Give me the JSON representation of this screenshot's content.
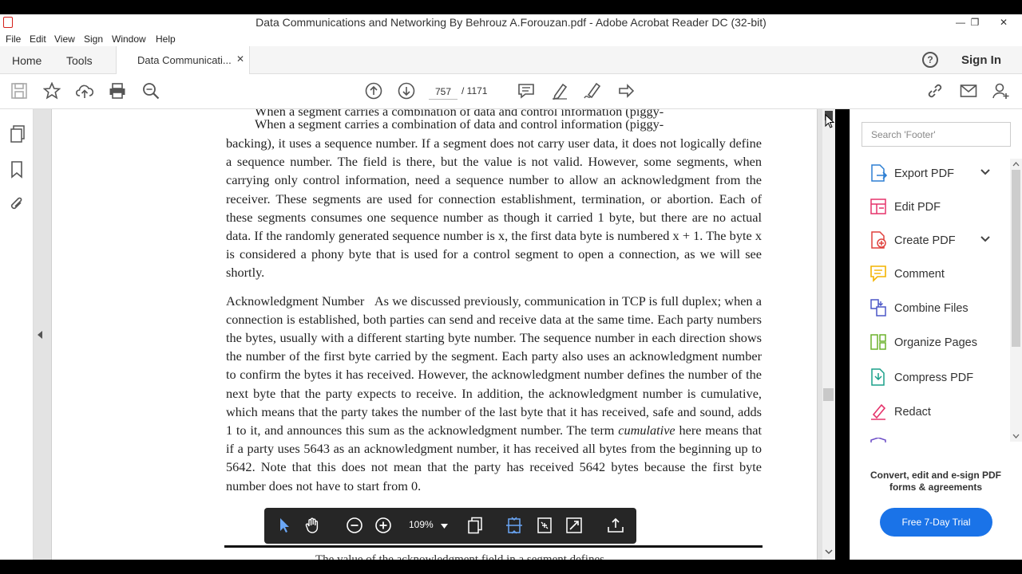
{
  "window": {
    "title": "Data Communications and Networking By Behrouz A.Forouzan.pdf - Adobe Acrobat Reader DC (32-bit)",
    "minimize": "—",
    "restore": "❐",
    "close": "✕"
  },
  "menu": [
    "File",
    "Edit",
    "View",
    "Sign",
    "Window",
    "Help"
  ],
  "tabs": {
    "home": "Home",
    "tools": "Tools",
    "document": "Data Communicati...",
    "close": "✕"
  },
  "header": {
    "help_icon": "?",
    "sign_in": "Sign In"
  },
  "toolbar": {
    "current_page": "757",
    "total_pages": "/ 1171"
  },
  "document": {
    "ghost_line": "When a segment carries a combination of data and control information (piggy-",
    "para1_first": "When a segment carries a combination of data and control information (piggy-",
    "para1_rest": "backing), it uses a sequence number. If a segment does not carry user data, it does not logically define a sequence number. The field is there, but the value is not valid. However, some segments, when carrying only control information, need a sequence number to allow an acknowledgment from the receiver. These segments are used for connection establishment, termination, or abortion. Each of these segments consumes one sequence number as though it carried 1 byte, but there are no actual data. If the randomly generated sequence number is x, the first data byte is numbered x + 1. The byte x is considered a phony byte that is used for a control segment to open a connection, as we will see shortly.",
    "para2_heading": "Acknowledgment Number",
    "para2_body_a": "As we discussed previously, communication in TCP is full duplex; when a connection is established, both parties can send and receive data at the same time. Each party numbers the bytes, usually with a different starting byte number. The sequence number in each direction shows the number of the first byte carried by the segment. Each party also uses an acknowledgment number to confirm the bytes it has received. However, the acknowledgment number defines the number of the next byte that the party expects to receive. In addition, the acknowledgment number is cumulative, which means that the party takes the number of the last byte that it has received, safe and sound, adds 1 to it, and announces this sum as the acknowledgment number. The term",
    "para2_em": "cumulative",
    "para2_body_b": "here means that if a party uses 5643 as an acknowledgment number, it has received all bytes from the beginning up to 5642. Note that this does not mean that the party has received 5642 bytes because the first byte number does not have to start from 0.",
    "next_line": "The value of the acknowledgment field in a segment defines"
  },
  "floating_toolbar": {
    "zoom": "109%"
  },
  "right_panel": {
    "search_placeholder": "Search 'Footer'",
    "tools": [
      {
        "label": "Export PDF",
        "color": "#2d7fd3"
      },
      {
        "label": "Edit PDF",
        "color": "#e5336b"
      },
      {
        "label": "Create PDF",
        "color": "#e0413d"
      },
      {
        "label": "Comment",
        "color": "#f4b400"
      },
      {
        "label": "Combine Files",
        "color": "#4b57c7"
      },
      {
        "label": "Organize Pages",
        "color": "#6bb22b"
      },
      {
        "label": "Compress PDF",
        "color": "#1aa08a"
      },
      {
        "label": "Redact",
        "color": "#e5336b"
      }
    ],
    "promo": "Convert, edit and e-sign PDF forms & agreements",
    "trial_button": "Free 7-Day Trial"
  }
}
